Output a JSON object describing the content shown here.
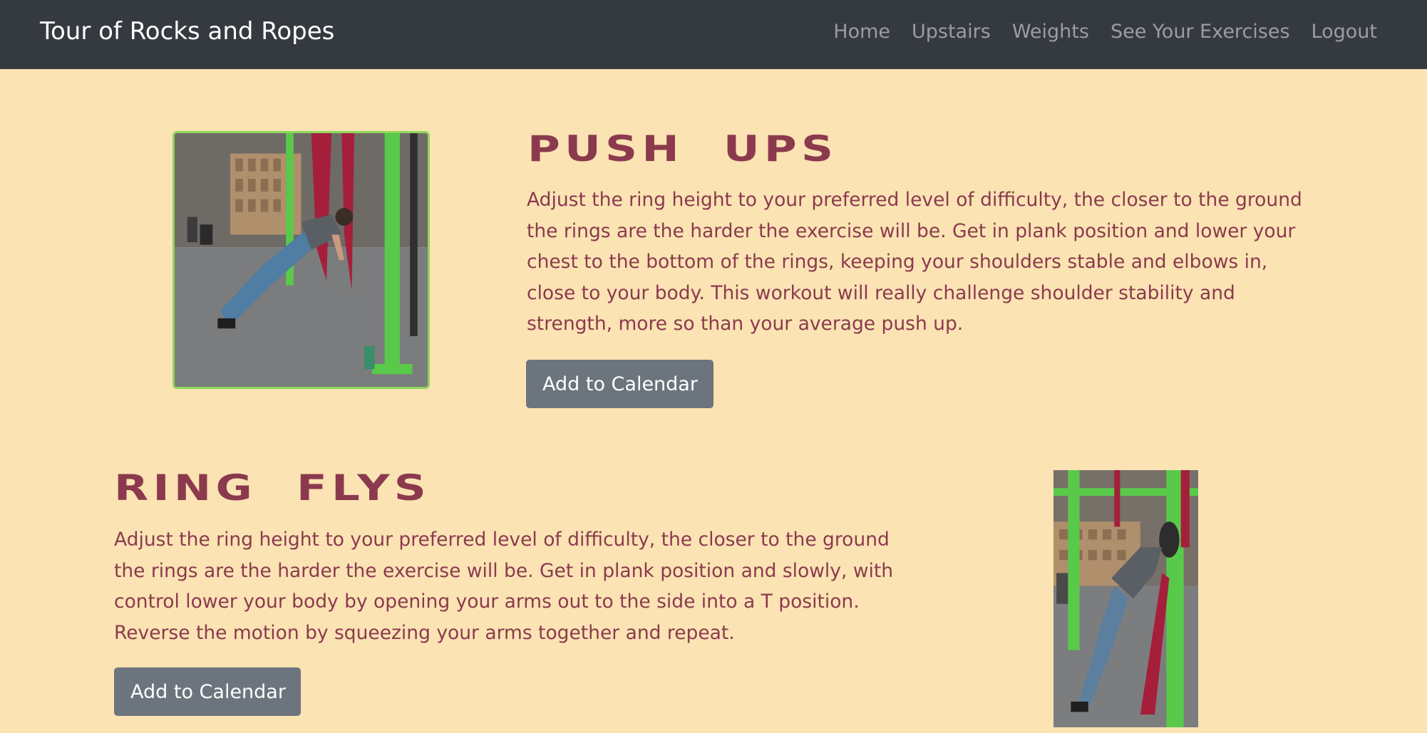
{
  "navbar": {
    "brand": "Tour of Rocks and Ropes",
    "links": [
      "Home",
      "Upstairs",
      "Weights",
      "See Your Exercises",
      "Logout"
    ]
  },
  "exercises": [
    {
      "title": "PUSH  UPS",
      "description": "Adjust the ring height to your preferred level of difficulty, the closer to the ground the rings are the harder the exercise will be. Get in plank position and lower your chest to the bottom of the rings, keeping your shoulders stable and elbows in, close to your body. This workout will really challenge shoulder stability and strength, more so than your average push up.",
      "button_label": "Add to Calendar"
    },
    {
      "title": "RING  FLYS",
      "description": "Adjust the ring height to your preferred level of difficulty, the closer to the ground the rings are the harder the exercise will be. Get in plank position and slowly, with control lower your body by opening your arms out to the side into a T position. Reverse the motion by squeezing your arms together and repeat.",
      "button_label": "Add to Calendar"
    }
  ],
  "colors": {
    "background": "#fbe3b3",
    "navbar": "#343a40",
    "accent_text": "#8b3a4e",
    "button": "#6c757d",
    "image_border": "#8fd65a"
  }
}
